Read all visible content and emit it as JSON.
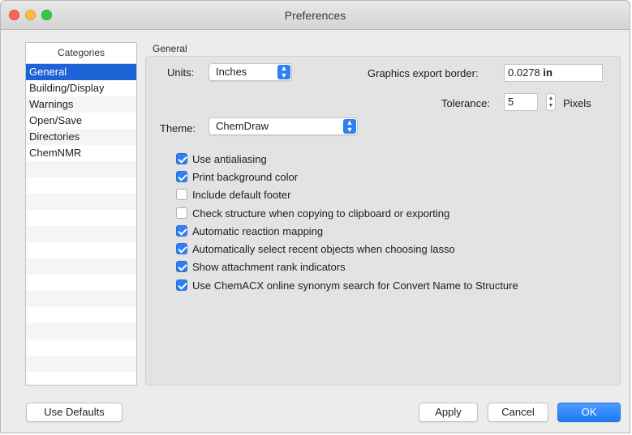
{
  "window": {
    "title": "Preferences"
  },
  "categories": {
    "header": "Categories",
    "items": [
      "General",
      "Building/Display",
      "Warnings",
      "Open/Save",
      "Directories",
      "ChemNMR"
    ],
    "selected_index": 0
  },
  "general": {
    "group_title": "General",
    "units_label": "Units:",
    "units_value": "Inches",
    "export_border_label": "Graphics export border:",
    "export_border_value": "0.0278",
    "export_border_unit": "in",
    "tolerance_label": "Tolerance:",
    "tolerance_value": "5",
    "tolerance_unit": "Pixels",
    "theme_label": "Theme:",
    "theme_value": "ChemDraw",
    "options": [
      {
        "label": "Use antialiasing",
        "checked": true
      },
      {
        "label": "Print background color",
        "checked": true
      },
      {
        "label": "Include default footer",
        "checked": false
      },
      {
        "label": "Check structure when copying to clipboard or exporting",
        "checked": false
      },
      {
        "label": "Automatic reaction mapping",
        "checked": true
      },
      {
        "label": "Automatically select recent objects when choosing lasso",
        "checked": true
      },
      {
        "label": "Show attachment rank indicators",
        "checked": true
      },
      {
        "label": "Use ChemACX online synonym search for Convert Name to Structure",
        "checked": true
      }
    ]
  },
  "buttons": {
    "use_defaults": "Use Defaults",
    "apply": "Apply",
    "cancel": "Cancel",
    "ok": "OK"
  },
  "colors": {
    "accent": "#2f7ff0",
    "selection": "#1e63d6"
  }
}
